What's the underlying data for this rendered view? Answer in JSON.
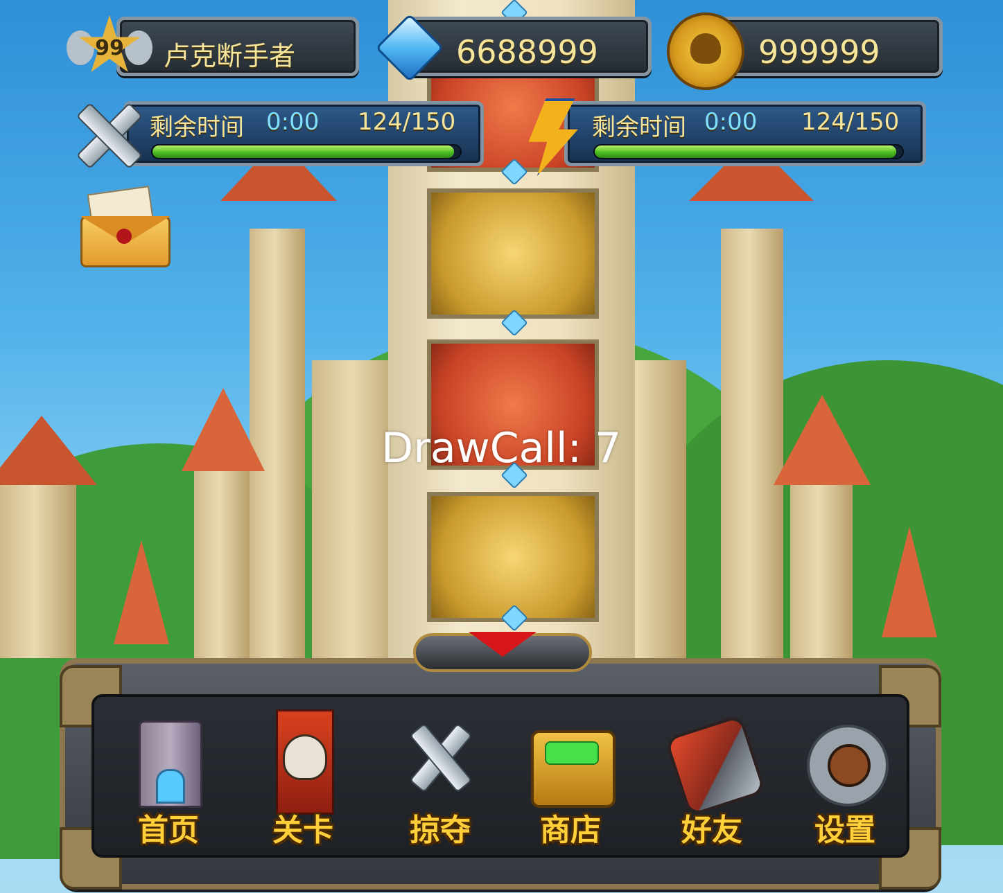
{
  "player": {
    "level": "99",
    "name": "卢克断手者"
  },
  "currency": {
    "gems": "6688999",
    "gold": "999999"
  },
  "stamina": [
    {
      "label": "剩余时间",
      "timer": "0:00",
      "count": "124/150",
      "icon": "crossed-swords-icon",
      "fill_fraction": 0.98
    },
    {
      "label": "剩余时间",
      "timer": "0:00",
      "count": "124/150",
      "icon": "lightning-bolt-icon",
      "fill_fraction": 0.98
    }
  ],
  "debug": {
    "drawcall": "DrawCall: 7"
  },
  "menu": {
    "items": [
      {
        "label": "首页",
        "icon": "castle-tower-icon"
      },
      {
        "label": "关卡",
        "icon": "skull-banner-icon"
      },
      {
        "label": "掠夺",
        "icon": "crossed-swords-icon"
      },
      {
        "label": "商店",
        "icon": "treasure-chest-icon"
      },
      {
        "label": "好友",
        "icon": "gauntlet-icon"
      },
      {
        "label": "设置",
        "icon": "gear-shield-icon"
      }
    ]
  },
  "colors": {
    "hud_text": "#f6e59a",
    "menu_label": "#ffcf3a",
    "progress_fill": "#4fbf23",
    "sky": "#4fb0ea"
  }
}
